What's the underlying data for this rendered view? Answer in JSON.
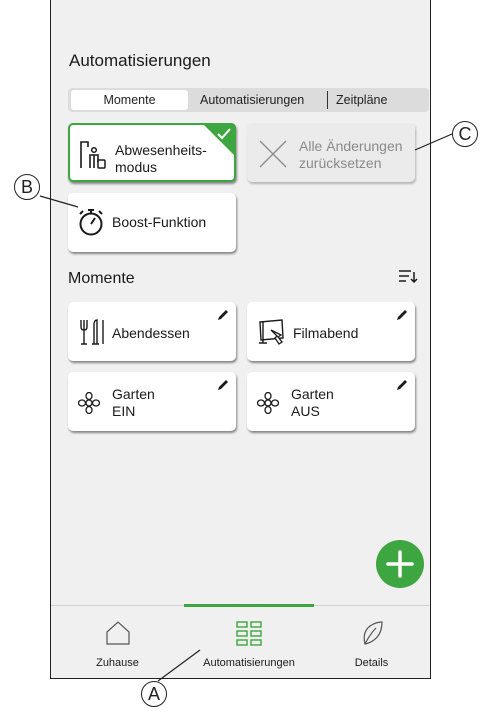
{
  "header": {
    "title": "Automatisierungen"
  },
  "tabs": [
    {
      "label": "Momente",
      "active": true
    },
    {
      "label": "Automatisierungen",
      "active": false
    },
    {
      "label": "Zeitpläne",
      "active": false
    }
  ],
  "quick_actions": {
    "away": {
      "label_line1": "Abwesenheits-",
      "label_line2": "modus",
      "icon": "away-mode-icon",
      "selected": true
    },
    "reset": {
      "label_line1": "Alle Änderungen",
      "label_line2": "zurücksetzen",
      "icon": "close-x-icon",
      "disabled": true
    },
    "boost": {
      "label": "Boost-Funktion",
      "icon": "stopwatch-icon"
    }
  },
  "moments": {
    "title": "Momente",
    "items": [
      {
        "label_line1": "Abendessen",
        "label_line2": "",
        "icon": "dinner-icon"
      },
      {
        "label_line1": "Filmabend",
        "label_line2": "",
        "icon": "movie-icon"
      },
      {
        "label_line1": "Garten",
        "label_line2": "EIN",
        "icon": "flower-icon"
      },
      {
        "label_line1": "Garten",
        "label_line2": "AUS",
        "icon": "flower-icon"
      }
    ]
  },
  "bottom_nav": [
    {
      "label": "Zuhause",
      "icon": "home-icon",
      "active": false
    },
    {
      "label": "Automatisierungen",
      "icon": "grid-icon",
      "active": true
    },
    {
      "label": "Details",
      "icon": "leaf-icon",
      "active": false
    }
  ],
  "callouts": {
    "a": "A",
    "b": "B",
    "c": "C"
  },
  "colors": {
    "accent": "#3da640",
    "background": "#f0f0f0",
    "card": "#ffffff",
    "disabled_text": "#8a8a8a"
  }
}
